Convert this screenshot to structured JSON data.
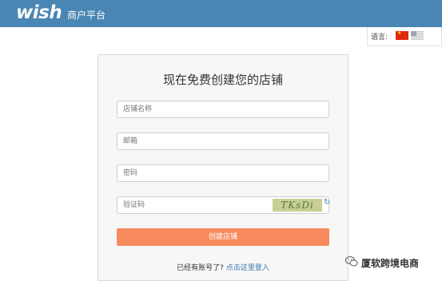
{
  "header": {
    "logo": "wish",
    "platform": "商户平台"
  },
  "language": {
    "label": "语言:",
    "flags": [
      "cn-flag-icon",
      "us-flag-icon"
    ]
  },
  "form": {
    "title": "现在免费创建您的店铺",
    "store_name_placeholder": "店铺名称",
    "email_placeholder": "邮箱",
    "password_placeholder": "密码",
    "captcha_placeholder": "验证码",
    "captcha_code": "TKsDi",
    "submit_label": "创建店铺",
    "login_prompt": "已经有账号了?",
    "login_link": "点击这里登入"
  },
  "watermark": {
    "icon": "wechat-icon",
    "text": "厦软跨境电商"
  },
  "colors": {
    "header_bg": "#4a86b3",
    "button_bg": "#f88b5d",
    "link": "#3a78b0"
  }
}
